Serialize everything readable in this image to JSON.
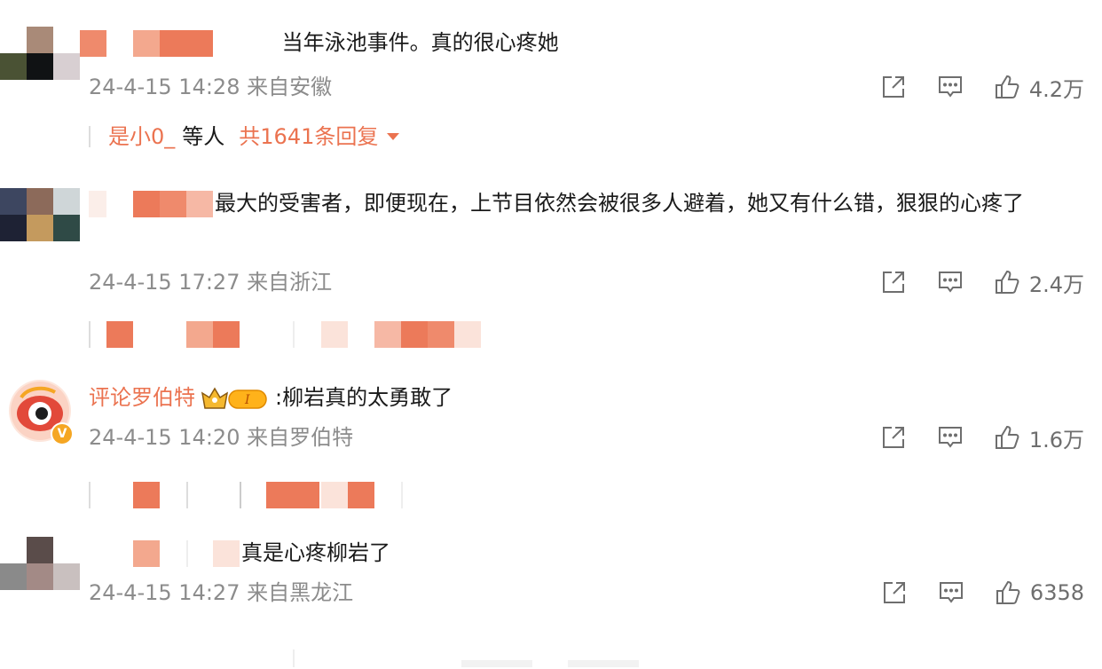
{
  "comments": [
    {
      "text": "当年泳池事件。真的很心疼她",
      "time": "24-4-15 14:28",
      "location": "来自安徽",
      "likes": "4.2万",
      "replies": {
        "user": "是小0_",
        "others": "等人",
        "count": "共1641条回复"
      }
    },
    {
      "text": "最大的受害者，即便现在，上节目依然会被很多人避着，她又有什么错，狠狠的心疼了",
      "time": "24-4-15 17:27",
      "location": "来自浙江",
      "likes": "2.4万"
    },
    {
      "user": "评论罗伯特",
      "text": ":柳岩真的太勇敢了",
      "time": "24-4-15 14:20",
      "location": "来自罗伯特",
      "likes": "1.6万",
      "badge_level": "I",
      "verified": "V"
    },
    {
      "text": "真是心疼柳岩了",
      "time": "24-4-15 14:27",
      "location": "来自黑龙江",
      "likes": "6358"
    }
  ],
  "icons": [
    "share-icon",
    "comment-icon",
    "like-icon",
    "dropdown-arrow-icon",
    "crown-badge-icon",
    "verified-icon"
  ],
  "colors": {
    "accent": "#eb7350",
    "meta": "#8c8c8c",
    "icon": "#6e6e6e"
  }
}
